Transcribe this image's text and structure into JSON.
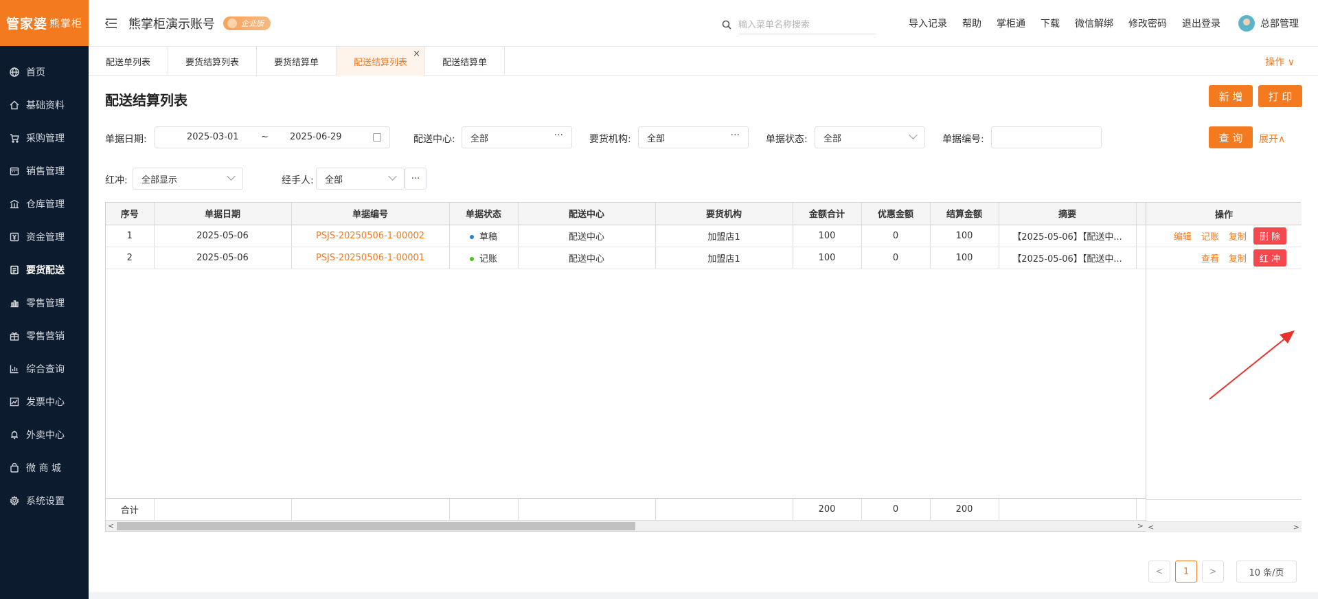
{
  "brand": {
    "name": "管家婆",
    "sub": "熊掌柜"
  },
  "sidebar": {
    "items": [
      {
        "label": "首页",
        "icon": "globe-icon"
      },
      {
        "label": "基础资料",
        "icon": "home-icon"
      },
      {
        "label": "采购管理",
        "icon": "cart-icon"
      },
      {
        "label": "销售管理",
        "icon": "calendar-icon"
      },
      {
        "label": "仓库管理",
        "icon": "warehouse-icon"
      },
      {
        "label": "资金管理",
        "icon": "money-icon"
      },
      {
        "label": "要货配送",
        "icon": "document-icon",
        "active": true
      },
      {
        "label": "零售管理",
        "icon": "bar-chart-icon"
      },
      {
        "label": "零售营销",
        "icon": "gift-icon"
      },
      {
        "label": "综合查询",
        "icon": "chart-icon"
      },
      {
        "label": "发票中心",
        "icon": "line-chart-icon"
      },
      {
        "label": "外卖中心",
        "icon": "bell-icon"
      },
      {
        "label": "微 商 城",
        "icon": "bag-icon"
      },
      {
        "label": "系统设置",
        "icon": "gear-icon"
      }
    ]
  },
  "header": {
    "account": "熊掌柜演示账号",
    "badge": "企业版",
    "search_placeholder": "输入菜单名称搜索",
    "links": [
      "导入记录",
      "帮助",
      "掌柜通",
      "下载",
      "微信解绑",
      "修改密码",
      "退出登录"
    ],
    "user": "总部管理"
  },
  "tabs": [
    {
      "label": "配送单列表"
    },
    {
      "label": "要货结算列表"
    },
    {
      "label": "要货结算单"
    },
    {
      "label": "配送结算列表",
      "active": true,
      "close": "×"
    },
    {
      "label": "配送结算单"
    }
  ],
  "tab_operate": "操作 ∨",
  "page": {
    "title": "配送结算列表",
    "add_button": "新 增",
    "print_button": "打 印",
    "query_button": "查 询",
    "expand_link": "展开∧"
  },
  "filters": {
    "date_label": "单据日期:",
    "date_from": "2025-03-01",
    "date_sep": "~",
    "date_to": "2025-06-29",
    "center_label": "配送中心:",
    "center_value": "全部",
    "org_label": "要货机构:",
    "org_value": "全部",
    "status_label": "单据状态:",
    "status_value": "全部",
    "no_label": "单据编号:",
    "no_value": "",
    "red_label": "红冲:",
    "red_value": "全部显示",
    "handler_label": "经手人:",
    "handler_value": "全部"
  },
  "table": {
    "headers": [
      "序号",
      "单据日期",
      "单据编号",
      "单据状态",
      "配送中心",
      "要货机构",
      "金额合计",
      "优惠金额",
      "结算金额",
      "摘要",
      "",
      "操作"
    ],
    "rows": [
      {
        "seq": "1",
        "date": "2025-05-06",
        "no": "PSJS-20250506-1-00002",
        "status": "草稿",
        "status_color": "#2f7de1",
        "center": "配送中心",
        "org": "加盟店1",
        "total": "100",
        "discount": "0",
        "settle": "100",
        "memo": "【2025-05-06】【配送中...",
        "ops": {
          "links": [
            "编辑",
            "记账",
            "复制"
          ],
          "button": "删 除"
        }
      },
      {
        "seq": "2",
        "date": "2025-05-06",
        "no": "PSJS-20250506-1-00001",
        "status": "记账",
        "status_color": "#52c41a",
        "center": "配送中心",
        "org": "加盟店1",
        "total": "100",
        "discount": "0",
        "settle": "100",
        "memo": "【2025-05-06】【配送中...",
        "ops": {
          "links": [
            "查看",
            "复制"
          ],
          "button": "红 冲"
        }
      }
    ],
    "summary": {
      "label": "合计",
      "total": "200",
      "discount": "0",
      "settle": "200"
    }
  },
  "pagination": {
    "prev": "<",
    "current": "1",
    "next": ">",
    "size": "10 条/页"
  },
  "colors": {
    "accent": "#f47a20",
    "danger": "#f5484f",
    "sidebar": "#0d1b2e",
    "annotation_arrow": "#e8322b"
  }
}
